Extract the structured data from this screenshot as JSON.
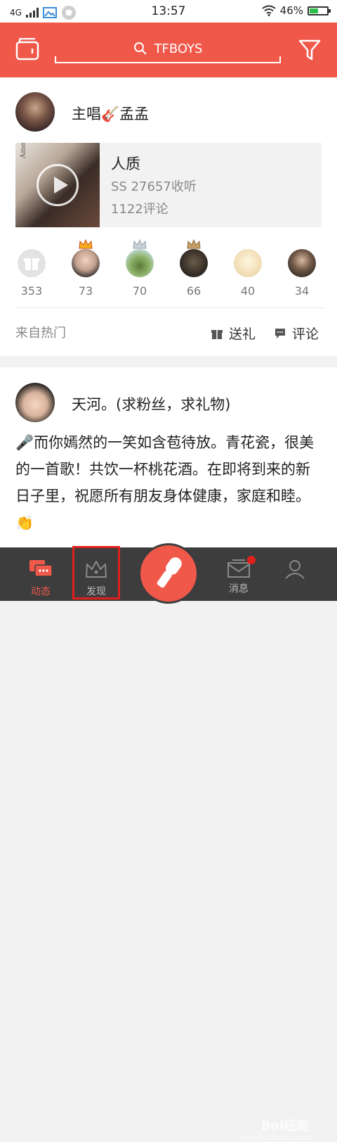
{
  "status_bar": {
    "network": "4G",
    "time": "13:57",
    "battery": "46%",
    "battery_level": 0.46
  },
  "header": {
    "search_text": "TFBOYS",
    "left_icon": "wallet-icon",
    "right_icon": "filter-icon",
    "accent_color": "#f0584a"
  },
  "post1": {
    "username": "主唱🎸孟孟",
    "song": {
      "title": "人质",
      "meta": "SS   27657收听",
      "comments": "1122评论",
      "cover_text": "Amei"
    },
    "gifters": [
      {
        "count": "353",
        "crown": "",
        "avatar": "gift-icon"
      },
      {
        "count": "73",
        "crown": "gold"
      },
      {
        "count": "70",
        "crown": "silver"
      },
      {
        "count": "66",
        "crown": "bronze"
      },
      {
        "count": "40",
        "crown": ""
      },
      {
        "count": "34",
        "crown": ""
      }
    ],
    "source": "来自热门",
    "gift_label": "送礼",
    "comment_label": "评论"
  },
  "post2": {
    "username": "天河。(求粉丝，求礼物)",
    "text": "🎤而你嫣然的一笑如含苞待放。青花瓷，很美的一首歌！共饮一杯桃花酒。在即将到来的新日子里，祝愿所有朋友身体健康，家庭和睦。👏"
  },
  "bottom_nav": {
    "items": [
      {
        "label": "动态",
        "icon": "feed-icon",
        "active": true
      },
      {
        "label": "发现",
        "icon": "crown-icon",
        "active": false
      },
      {
        "label": "",
        "icon": "microphone-icon",
        "active": false
      },
      {
        "label": "消息",
        "icon": "mail-icon",
        "active": false
      },
      {
        "label": "",
        "icon": "profile-icon",
        "active": false
      }
    ]
  },
  "watermark": {
    "text": "Bai经验",
    "sub": "jingyan.baidu.com"
  }
}
